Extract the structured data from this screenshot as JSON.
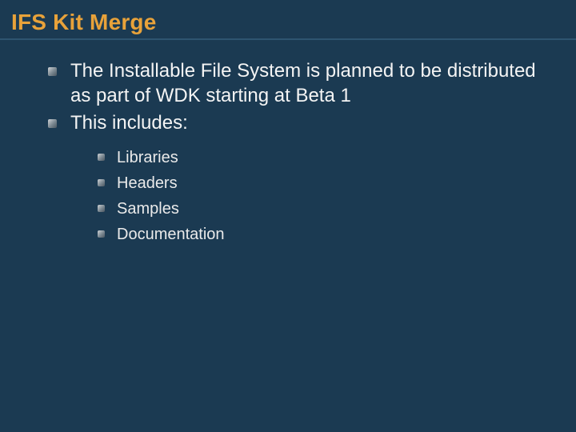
{
  "title": "IFS Kit Merge",
  "bullets": [
    {
      "text": "The Installable File System is planned to be distributed as part of WDK starting at Beta 1"
    },
    {
      "text": "This includes:"
    }
  ],
  "sub_bullets": [
    {
      "text": "Libraries"
    },
    {
      "text": "Headers"
    },
    {
      "text": "Samples"
    },
    {
      "text": "Documentation"
    }
  ],
  "colors": {
    "background": "#1b3a52",
    "title": "#e8a23a",
    "body_text": "#f4f4f4"
  }
}
